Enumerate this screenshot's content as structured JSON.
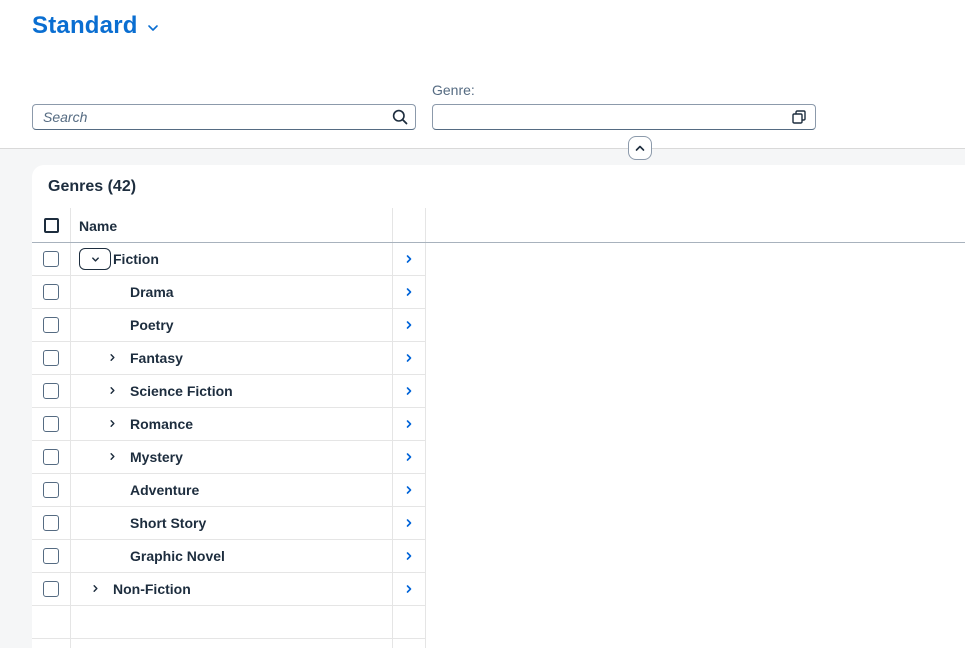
{
  "header": {
    "variant_title": "Standard",
    "search_placeholder": "Search",
    "search_value": "",
    "genre_label": "Genre:",
    "genre_value": ""
  },
  "table": {
    "title": "Genres (42)",
    "column_name": "Name",
    "rows": [
      {
        "label": "Fiction",
        "level": 0,
        "expander": "expanded"
      },
      {
        "label": "Drama",
        "level": 1,
        "expander": "none"
      },
      {
        "label": "Poetry",
        "level": 1,
        "expander": "none"
      },
      {
        "label": "Fantasy",
        "level": 1,
        "expander": "collapsed"
      },
      {
        "label": "Science Fiction",
        "level": 1,
        "expander": "collapsed"
      },
      {
        "label": "Romance",
        "level": 1,
        "expander": "collapsed"
      },
      {
        "label": "Mystery",
        "level": 1,
        "expander": "collapsed"
      },
      {
        "label": "Adventure",
        "level": 1,
        "expander": "none"
      },
      {
        "label": "Short Story",
        "level": 1,
        "expander": "none"
      },
      {
        "label": "Graphic Novel",
        "level": 1,
        "expander": "none"
      },
      {
        "label": "Non-Fiction",
        "level": 0,
        "expander": "collapsed"
      }
    ]
  },
  "icons": {
    "variant_dropdown": "chevron-down-icon",
    "search": "search-icon",
    "value_help": "value-help-icon",
    "collapse_header": "chevron-up-icon",
    "row_navigation": "chevron-right-icon"
  },
  "colors": {
    "brand": "#0a6ed1",
    "text": "#1d2d3e",
    "nav_arrow": "#0064d9",
    "background": "#f5f6f7"
  }
}
